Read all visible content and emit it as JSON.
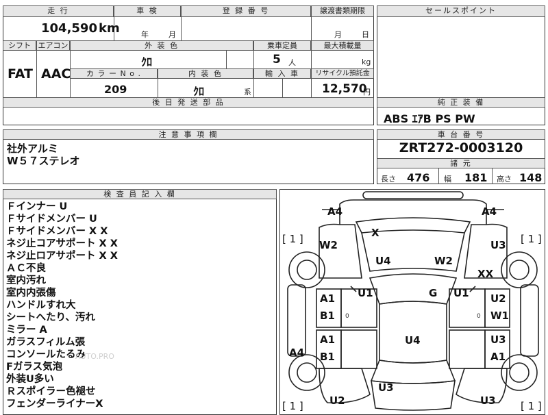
{
  "top_header": {
    "mileage_label": "走 行",
    "inspection_label": "車 検",
    "registration_label": "登 録 番 号",
    "transfer_deadline_label": "譲渡書類期限",
    "sales_point_label": "セールスポイント"
  },
  "top_values": {
    "mileage": "104,590",
    "mileage_unit": "km",
    "inspection_year_unit": "年",
    "inspection_month_unit": "月",
    "transfer_month_unit": "月",
    "transfer_day_unit": "日"
  },
  "spec_header": {
    "shift_label": "シフト",
    "aircon_label": "エアコン",
    "exterior_color_label": "外 装 色",
    "capacity_label": "乗車定員",
    "max_load_label": "最大積載量"
  },
  "spec_values": {
    "shift": "FAT",
    "aircon": "AAC",
    "exterior_color": "ｸﾛ",
    "capacity": "5",
    "capacity_unit": "人",
    "max_load_unit": "kg"
  },
  "spec_sub_header": {
    "color_no_label": "カ ラ ー N o .",
    "interior_color_label": "内 装 色",
    "import_label": "輸 入 車",
    "recycle_label": "リサイクル預託金"
  },
  "spec_sub_values": {
    "color_no": "209",
    "interior_color": "ｸﾛ",
    "interior_suffix": "系",
    "recycle_fee": "12,570",
    "recycle_unit": "円"
  },
  "later_parts_label": "後 日 発 送 部 品",
  "standard_equipment": {
    "label": "純 正 装 備",
    "value": "ABS ｴｱB PS PW"
  },
  "notes": {
    "label": "注 意 事 項 欄",
    "lines": [
      "社外アルミ",
      "W５７ステレオ"
    ]
  },
  "chassis": {
    "label": "車 台 番 号",
    "value": "ZRT272-0003120"
  },
  "dimensions": {
    "label": "諸 元",
    "length_label": "長さ",
    "length": "476",
    "width_label": "幅",
    "width": "181",
    "height_label": "高さ",
    "height": "148"
  },
  "inspector": {
    "label": "検 査 員 記 入 欄",
    "lines": [
      "Ｆインナー U",
      "Ｆサイドメンバー U",
      "Ｆサイドメンバー X X",
      "ネジ止コアサポート X X",
      "ネジ止ロアサポート X X",
      "ＡＣ不良",
      "室内汚れ",
      "室内内張傷",
      "ハンドルすれ大",
      "シートへたり、汚れ",
      "ミラー A",
      "ガラスフィルム張",
      "コンソールたるみ",
      "Fガラス気泡",
      "外装U多い",
      "Ｒスポイラー色褪せ",
      "フェンダーライナーX"
    ]
  },
  "diagram": {
    "marks": [
      {
        "id": "front-left-corner",
        "text": "A4"
      },
      {
        "id": "front-right-corner",
        "text": "A4"
      },
      {
        "id": "bracket-left-top",
        "text": "[ 1 ]"
      },
      {
        "id": "bracket-right-top",
        "text": "[ 1 ]"
      },
      {
        "id": "bracket-left-bottom",
        "text": "[ 1 ]"
      },
      {
        "id": "bracket-right-bottom",
        "text": "[ 1 ]"
      },
      {
        "id": "front-x",
        "text": "X"
      },
      {
        "id": "left-fender",
        "text": "W2"
      },
      {
        "id": "right-fender",
        "text": "U3"
      },
      {
        "id": "hood-left",
        "text": "U4"
      },
      {
        "id": "hood-right",
        "text": "W2"
      },
      {
        "id": "right-wheel",
        "text": "XX"
      },
      {
        "id": "left-front-door",
        "text": "A1"
      },
      {
        "id": "left-front-door-2",
        "text": "B1"
      },
      {
        "id": "left-pillar",
        "text": "U1"
      },
      {
        "id": "windshield",
        "text": "G"
      },
      {
        "id": "right-pillar",
        "text": "U1"
      },
      {
        "id": "right-front-door",
        "text": "U2"
      },
      {
        "id": "right-front-door-2",
        "text": "W1"
      },
      {
        "id": "left-rear-door",
        "text": "A1"
      },
      {
        "id": "left-rear-door-2",
        "text": "B1"
      },
      {
        "id": "roof",
        "text": "U4"
      },
      {
        "id": "right-rear-door",
        "text": "U3"
      },
      {
        "id": "right-rear-door-2",
        "text": "A1"
      },
      {
        "id": "left-sill",
        "text": "A4"
      },
      {
        "id": "trunk",
        "text": "U3"
      },
      {
        "id": "rear-left",
        "text": "U2"
      },
      {
        "id": "rear-right",
        "text": "U3"
      }
    ]
  },
  "watermark": "AUTO.PRO"
}
